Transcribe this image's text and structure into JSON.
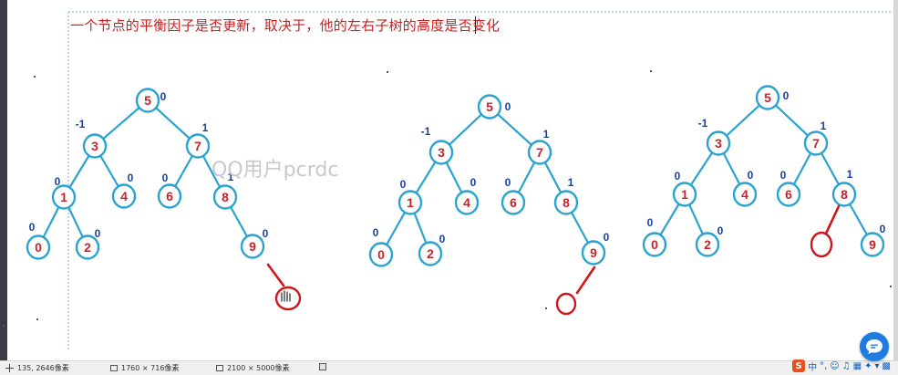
{
  "annotation": {
    "text": "一个节点的平衡因子是否更新，取决于，他的左右子树的高度是否变化"
  },
  "watermark": "QQ用户pcrdc",
  "colors": {
    "node_outline": "#2aa3cf",
    "edge": "#2aa3cf",
    "node_value": "#c8232c",
    "balance_factor": "#1b3fa0",
    "new_node": "#d0151b",
    "annotation": "#cc1f1f"
  },
  "trees": [
    {
      "nodes": [
        {
          "value": "5",
          "bf": "0"
        },
        {
          "value": "3",
          "bf": "-1"
        },
        {
          "value": "7",
          "bf": "1"
        },
        {
          "value": "1",
          "bf": "0"
        },
        {
          "value": "4",
          "bf": "0"
        },
        {
          "value": "6",
          "bf": "0"
        },
        {
          "value": "8",
          "bf": "1"
        },
        {
          "value": "0",
          "bf": "0"
        },
        {
          "value": "2",
          "bf": "0"
        },
        {
          "value": "9",
          "bf": "0"
        }
      ]
    },
    {
      "nodes": [
        {
          "value": "5",
          "bf": "0"
        },
        {
          "value": "3",
          "bf": "-1"
        },
        {
          "value": "7",
          "bf": "1"
        },
        {
          "value": "1",
          "bf": "0"
        },
        {
          "value": "4",
          "bf": "0"
        },
        {
          "value": "6",
          "bf": "0"
        },
        {
          "value": "8",
          "bf": "1"
        },
        {
          "value": "0",
          "bf": "0"
        },
        {
          "value": "2",
          "bf": "0"
        },
        {
          "value": "9",
          "bf": "0"
        }
      ]
    },
    {
      "nodes": [
        {
          "value": "5",
          "bf": "0"
        },
        {
          "value": "3",
          "bf": "-1"
        },
        {
          "value": "7",
          "bf": "1"
        },
        {
          "value": "1",
          "bf": "0"
        },
        {
          "value": "4",
          "bf": "0"
        },
        {
          "value": "6",
          "bf": "0"
        },
        {
          "value": "8",
          "bf": "1"
        },
        {
          "value": "0",
          "bf": "0"
        },
        {
          "value": "2",
          "bf": "0"
        },
        {
          "value": "9",
          "bf": "0"
        }
      ]
    }
  ],
  "status_bar": {
    "cursor_pos": "135, 2646像素",
    "selection_size": "1760 × 716像素",
    "image_size": "2100 × 5000像素"
  },
  "ime": {
    "lang": "中",
    "punct": "°,",
    "icons": [
      "emoji-icon",
      "mic-icon",
      "keyboard-icon",
      "toolbox-icon",
      "skin-icon",
      "grid-icon"
    ]
  }
}
